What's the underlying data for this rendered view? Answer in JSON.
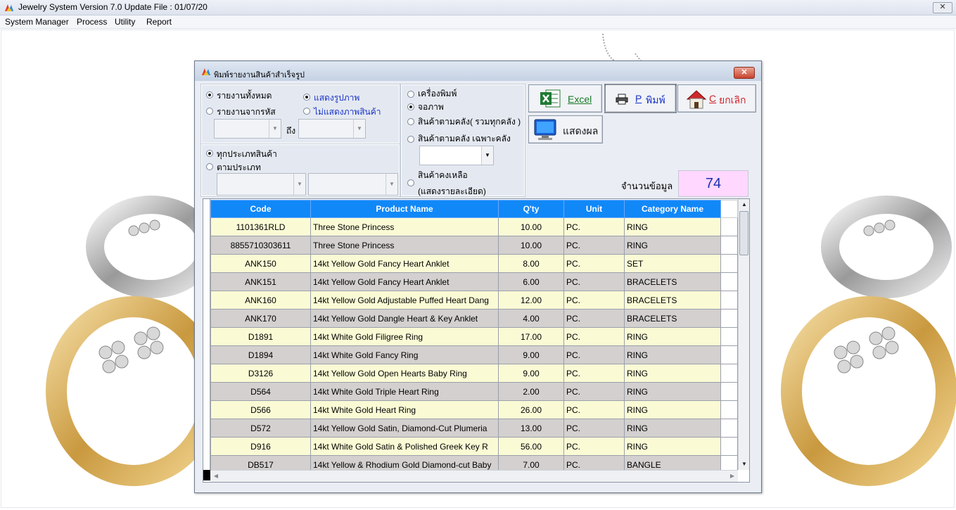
{
  "window": {
    "title": "Jewelry System Version 7.0 Update File : 01/07/20",
    "close_glyph": "✕"
  },
  "menu": [
    "System Manager",
    "Process",
    "Utility",
    "Report"
  ],
  "dialog": {
    "title": "พิมพ์รายงานสินค้าสำเร็จรูป",
    "close_glyph": "✕",
    "report_scope": {
      "all": "รายงานทั้งหมด",
      "by_code": "รายงานจากรหัส",
      "to": "ถึง",
      "selected": "all"
    },
    "picture": {
      "show": "แสดงรูปภาพ",
      "hide": "ไม่แสดงภาพสินค้า",
      "selected": "show"
    },
    "category": {
      "all": "ทุกประเภทสินค้า",
      "by_type": "ตามประเภท",
      "selected": "all"
    },
    "output": {
      "printer": "เครื่องพิมพ์",
      "screen": "จอภาพ",
      "by_warehouse_all": "สินค้าตามคลัง( รวมทุกคลัง )",
      "by_warehouse_specific": "สินค้าตามคลัง เฉพาะคลัง",
      "remaining": "สินค้าคงเหลือ",
      "remaining_detail": "(แสดงรายละเอียด)",
      "selected": "screen"
    },
    "buttons": {
      "excel": "Excel",
      "print_key": "P",
      "print": "พิมพ์",
      "cancel_key": "C",
      "cancel": "ยกเลิก",
      "show": "แสดงผล"
    },
    "record_count_label": "จำนวนข้อมูล",
    "record_count": "74"
  },
  "table": {
    "headers": [
      "Code",
      "Product Name",
      "Q'ty",
      "Unit",
      "Category Name"
    ],
    "rows": [
      [
        "1101361RLD",
        "Three Stone Princess",
        "10.00",
        "PC.",
        "RING"
      ],
      [
        "8855710303611",
        "Three Stone Princess",
        "10.00",
        "PC.",
        "RING"
      ],
      [
        "ANK150",
        "14kt Yellow Gold Fancy Heart Anklet",
        "8.00",
        "PC.",
        "SET"
      ],
      [
        "ANK151",
        "14kt Yellow Gold Fancy Heart Anklet",
        "6.00",
        "PC.",
        "BRACELETS"
      ],
      [
        "ANK160",
        "14kt Yellow Gold Adjustable Puffed Heart Dang",
        "12.00",
        "PC.",
        "BRACELETS"
      ],
      [
        "ANK170",
        "14kt Yellow Gold Dangle Heart & Key Anklet",
        "4.00",
        "PC.",
        "BRACELETS"
      ],
      [
        "D1891",
        "14kt White Gold Filigree Ring",
        "17.00",
        "PC.",
        "RING"
      ],
      [
        "D1894",
        "14kt White Gold Fancy Ring",
        "9.00",
        "PC.",
        "RING"
      ],
      [
        "D3126",
        "14kt Yellow Gold Open Hearts Baby Ring",
        "9.00",
        "PC.",
        "RING"
      ],
      [
        "D564",
        "14kt White Gold Triple Heart Ring",
        "2.00",
        "PC.",
        "RING"
      ],
      [
        "D566",
        "14kt White Gold Heart Ring",
        "26.00",
        "PC.",
        "RING"
      ],
      [
        "D572",
        "14kt Yellow Gold Satin, Diamond-Cut Plumeria",
        "13.00",
        "PC.",
        "RING"
      ],
      [
        "D916",
        "14kt White Gold Satin & Polished Greek Key R",
        "56.00",
        "PC.",
        "RING"
      ],
      [
        "DB517",
        "14kt Yellow & Rhodium Gold Diamond-cut Baby",
        "7.00",
        "PC.",
        "BANGLE"
      ]
    ]
  },
  "colors": {
    "header_bg": "#1188f8",
    "row_odd": "#fafbd5",
    "row_even": "#d3d0cf",
    "count_bg": "#ffd7ff"
  }
}
